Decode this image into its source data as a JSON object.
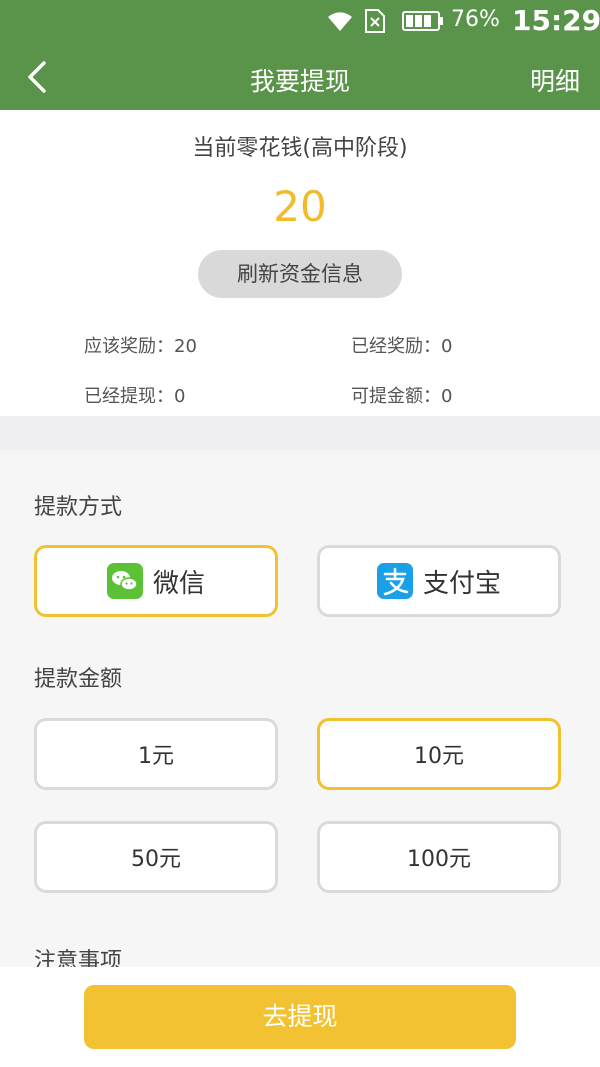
{
  "status_bar": {
    "battery": "76%",
    "time": "15:29"
  },
  "header": {
    "title": "我要提现",
    "detail_label": "明细"
  },
  "summary": {
    "label": "当前零花钱(高中阶段)",
    "amount": "20",
    "refresh_label": "刷新资金信息",
    "stats": {
      "due_reward": "应该奖励：20",
      "given_reward": "已经奖励：0",
      "withdrawn": "已经提现：0",
      "available": "可提金额：0"
    }
  },
  "payment": {
    "title": "提款方式",
    "methods": [
      {
        "label": "微信",
        "icon": "wechat-icon",
        "color": "#5bc236",
        "selected": true
      },
      {
        "label": "支付宝",
        "icon": "alipay-icon",
        "color": "#1aa0e6",
        "selected": false
      }
    ]
  },
  "amount_section": {
    "title": "提款金额",
    "options": [
      {
        "label": "1元",
        "selected": false
      },
      {
        "label": "10元",
        "selected": true
      },
      {
        "label": "50元",
        "selected": false
      },
      {
        "label": "100元",
        "selected": false
      }
    ]
  },
  "notes": {
    "title": "注意事项"
  },
  "submit": {
    "label": "去提现"
  },
  "colors": {
    "header": "#5a944a",
    "accent": "#f2c130",
    "amount": "#f1bb2a"
  }
}
